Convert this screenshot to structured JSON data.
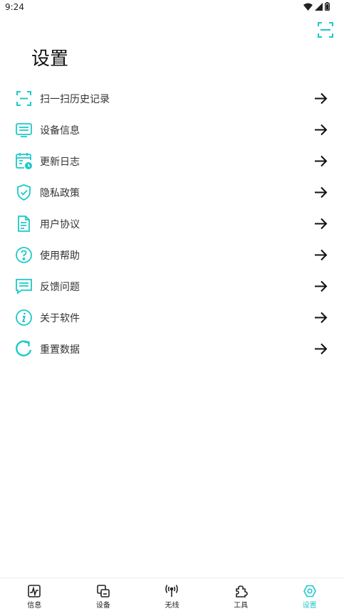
{
  "status_bar": {
    "time": "9:24"
  },
  "accent_color": "#1ec8c8",
  "page": {
    "title": "设置",
    "top_action_icon": "scan-icon"
  },
  "menu": [
    {
      "label": "扫一扫历史记录",
      "icon": "scan-icon"
    },
    {
      "label": "设备信息",
      "icon": "device-info-icon"
    },
    {
      "label": "更新日志",
      "icon": "calendar-clock-icon"
    },
    {
      "label": "隐私政策",
      "icon": "shield-check-icon"
    },
    {
      "label": "用户协议",
      "icon": "document-icon"
    },
    {
      "label": "使用帮助",
      "icon": "help-icon"
    },
    {
      "label": "反馈问题",
      "icon": "chat-icon"
    },
    {
      "label": "关于软件",
      "icon": "info-icon"
    },
    {
      "label": "重置数据",
      "icon": "refresh-icon"
    }
  ],
  "bottom_nav": {
    "active": "设置",
    "items": [
      {
        "label": "信息",
        "icon": "activity-icon"
      },
      {
        "label": "设备",
        "icon": "devices-icon"
      },
      {
        "label": "无线",
        "icon": "antenna-icon"
      },
      {
        "label": "工具",
        "icon": "puzzle-icon"
      },
      {
        "label": "设置",
        "icon": "settings-icon"
      }
    ]
  }
}
